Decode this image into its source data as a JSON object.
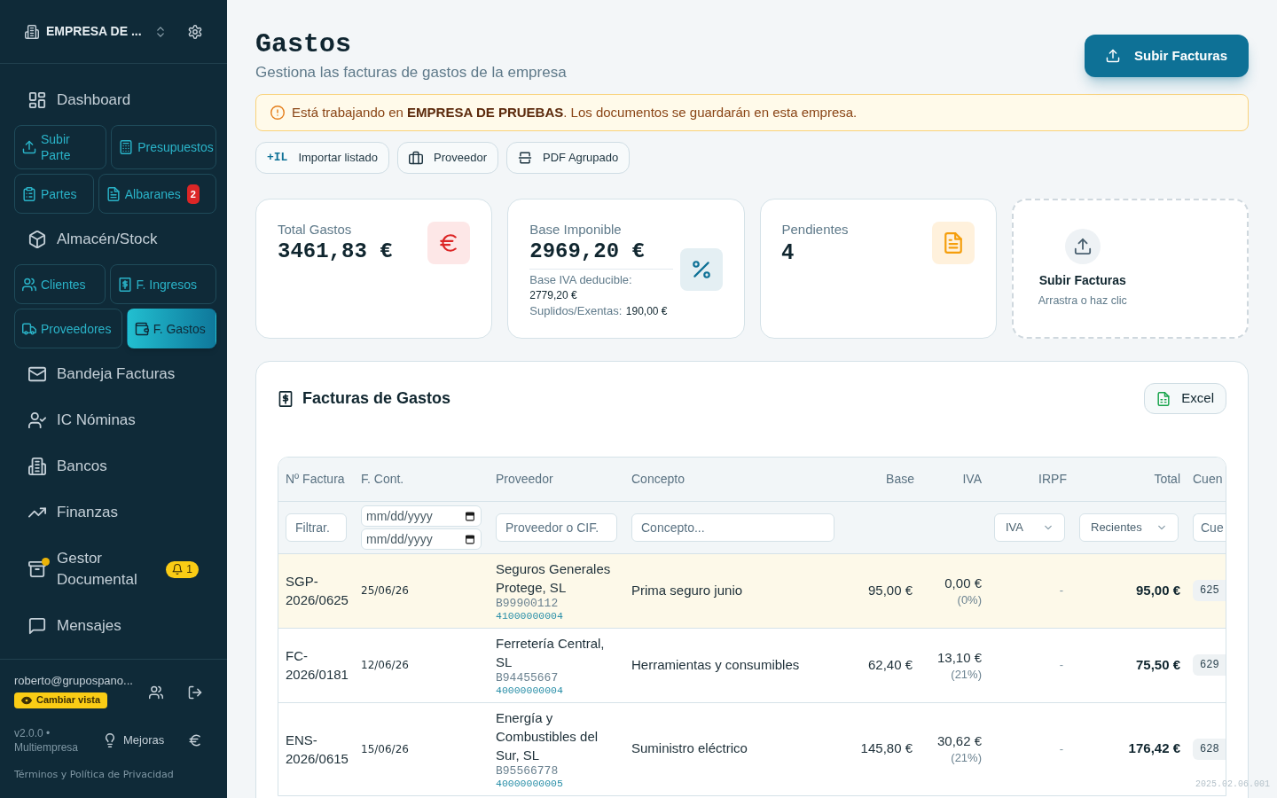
{
  "sidebar": {
    "company": "EMPRESA DE ...",
    "nav": [
      {
        "kind": "item",
        "label": "Dashboard",
        "selected": false,
        "alert_dot": false
      },
      {
        "kind": "tiles",
        "tiles": [
          {
            "label": "Subir Parte",
            "selected": false
          },
          {
            "label": "Presupuestos",
            "selected": false
          }
        ]
      },
      {
        "kind": "tiles",
        "tiles": [
          {
            "label": "Partes",
            "selected": false
          },
          {
            "label": "Albaranes",
            "selected": false,
            "badge": "2"
          }
        ]
      },
      {
        "kind": "item",
        "label": "Almacén/Stock",
        "selected": false,
        "alert_dot": false
      },
      {
        "kind": "tiles",
        "tiles": [
          {
            "label": "Clientes",
            "selected": false
          },
          {
            "label": "F. Ingresos",
            "selected": false
          }
        ]
      },
      {
        "kind": "tiles",
        "tiles": [
          {
            "label": "Proveedores",
            "selected": false
          },
          {
            "label": "F. Gastos",
            "selected": true
          }
        ]
      },
      {
        "kind": "item",
        "label": "Bandeja Facturas",
        "selected": false,
        "alert_dot": false
      },
      {
        "kind": "item",
        "label": "IC Nóminas",
        "selected": false,
        "alert_dot": false
      },
      {
        "kind": "item",
        "label": "Bancos",
        "selected": false,
        "alert_dot": false
      },
      {
        "kind": "item",
        "label": "Finanzas",
        "selected": false,
        "alert_dot": false
      },
      {
        "kind": "item",
        "label": "Gestor Documental",
        "selected": false,
        "alert_dot": true,
        "badge": "1"
      },
      {
        "kind": "item",
        "label": "Mensajes",
        "selected": false,
        "alert_dot": false
      }
    ],
    "user": {
      "email": "roberto@grupospano...",
      "switch_view": "Cambiar vista"
    },
    "version": "v2.0.0 • Multiempresa",
    "improvements": "Mejoras",
    "legal": "Términos y Política de Privacidad"
  },
  "header": {
    "title": "Gastos",
    "subtitle": "Gestiona las facturas de gastos de la empresa",
    "upload_button": "Subir Facturas"
  },
  "notice": "Está trabajando en **EMPRESA DE PRUEBAS**. Los documentos se guardarán en esta empresa.",
  "actions": [
    {
      "prefix": "+IL",
      "label": "Importar listado"
    },
    {
      "label": "Proveedor"
    },
    {
      "label": "PDF Agrupado"
    }
  ],
  "stats": [
    {
      "kind": "amount",
      "label": "Total Gastos",
      "value": "3461,83 €"
    },
    {
      "kind": "breakdown",
      "label": "Base Imponible",
      "value": "2969,20 €",
      "details": [
        {
          "label": "Base IVA deducible:",
          "value": "2779,20 €"
        },
        {
          "label": "Suplidos/Exentas:",
          "value": "190,00 €"
        }
      ]
    },
    {
      "kind": "count",
      "label": "Pendientes",
      "value": "4"
    },
    {
      "kind": "dropzone",
      "title": "Subir Facturas",
      "hint": "Arrastra o haz clic"
    }
  ],
  "invoices": {
    "title": "Facturas de Gastos",
    "export_button": "Excel",
    "columns": [
      {
        "label": "Nº Factura",
        "filter": {
          "kind": "text",
          "placeholder": "Filtrar."
        }
      },
      {
        "label": "F. Cont.",
        "filter": {
          "kind": "date_range",
          "placeholders": [
            "mm/dd/yyyy",
            "mm/dd/yyyy"
          ]
        }
      },
      {
        "label": "Proveedor",
        "filter": {
          "kind": "text",
          "placeholder": "Proveedor o CIF."
        }
      },
      {
        "label": "Concepto",
        "filter": {
          "kind": "text",
          "placeholder": "Concepto..."
        }
      },
      {
        "label": "Base"
      },
      {
        "label": "IVA"
      },
      {
        "label": "IRPF",
        "filter": {
          "kind": "select",
          "value": "IVA"
        }
      },
      {
        "label": "Total",
        "filter": {
          "kind": "select",
          "value": "Recientes"
        }
      },
      {
        "label": "Cuen",
        "filter": {
          "kind": "text",
          "placeholder": "Cue"
        }
      }
    ],
    "rows": [
      {
        "highlighted": true,
        "number": "SGP-2026/0625",
        "date": "25/06/26",
        "supplier": "Seguros Generales Protege, SL",
        "tax_id": "B99900112",
        "supplier_account": "41000000004",
        "concept": "Prima seguro junio",
        "base": "95,00 €",
        "vat": "0,00 €",
        "vat_rate": "(0%)",
        "irpf": "-",
        "total": "95,00 €",
        "account": "625"
      },
      {
        "highlighted": false,
        "number": "FC-2026/0181",
        "date": "12/06/26",
        "supplier": "Ferretería Central, SL",
        "tax_id": "B94455667",
        "supplier_account": "40000000004",
        "concept": "Herramientas y consumibles",
        "base": "62,40 €",
        "vat": "13,10 €",
        "vat_rate": "(21%)",
        "irpf": "-",
        "total": "75,50 €",
        "account": "629"
      },
      {
        "highlighted": false,
        "number": "ENS-2026/0615",
        "date": "15/06/26",
        "supplier": "Energía y Combustibles del Sur, SL",
        "tax_id": "B95566778",
        "supplier_account": "40000000005",
        "concept": "Suministro eléctrico",
        "base": "145,80 €",
        "vat": "30,62 €",
        "vat_rate": "(21%)",
        "irpf": "-",
        "total": "176,42 €",
        "account": "628"
      }
    ]
  },
  "build_stamp": "2025.02.06.001"
}
